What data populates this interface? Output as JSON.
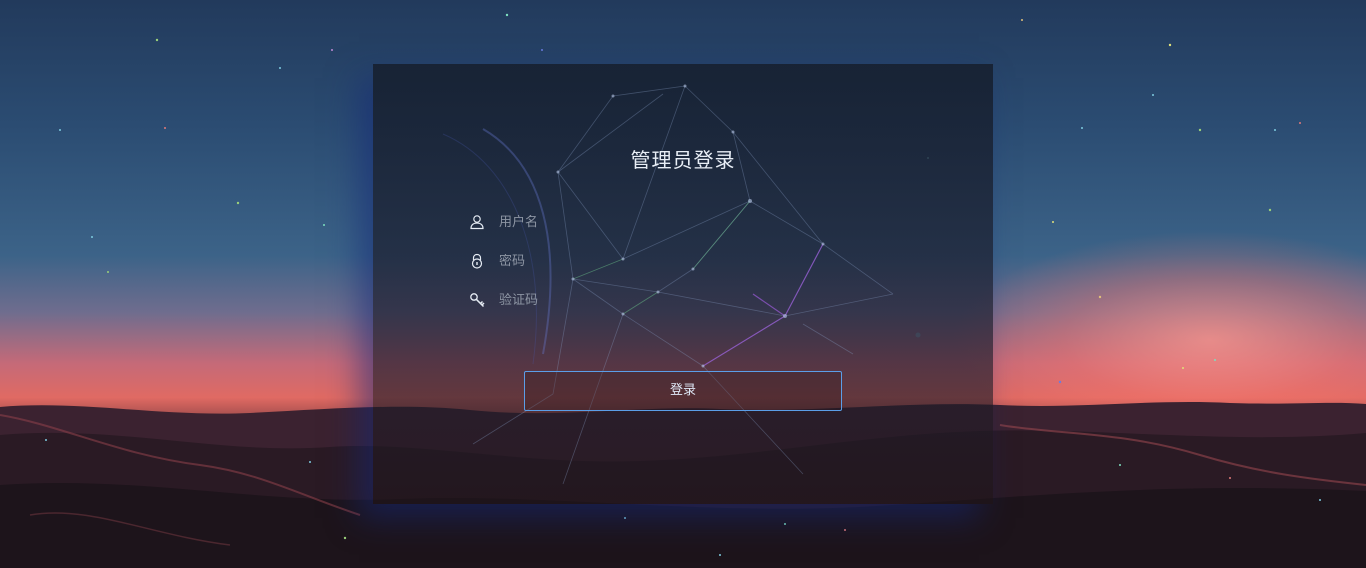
{
  "login": {
    "title": "管理员登录",
    "username": {
      "placeholder": "用户名",
      "value": "",
      "icon": "user-icon"
    },
    "password": {
      "placeholder": "密码",
      "value": "",
      "icon": "lock-icon"
    },
    "captcha": {
      "placeholder": "验证码",
      "value": "",
      "icon": "key-icon"
    },
    "submit_label": "登录"
  },
  "colors": {
    "button_border": "#5b9ee8",
    "title_text": "#e8eef6",
    "placeholder_text": "#8d95a3"
  }
}
